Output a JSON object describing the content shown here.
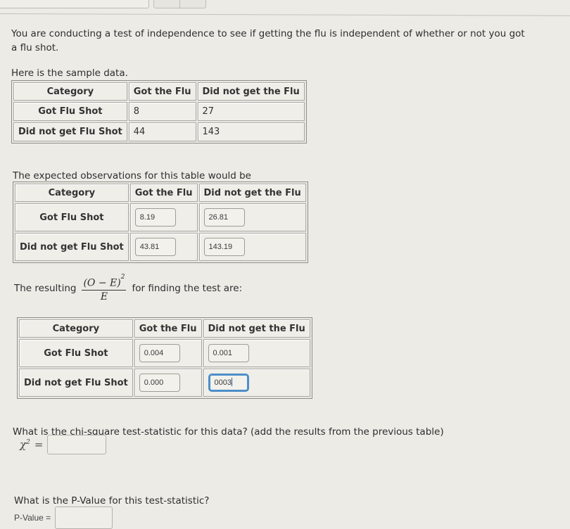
{
  "intro": {
    "question": "You are conducting a test of independence to see if getting the flu is independent of whether or not you got a flu shot.",
    "sample_label": "Here is the sample data.",
    "expected_label": "The expected observations for this table would be",
    "resulting_prefix": "The resulting",
    "formula_numerator": "(O − E)",
    "formula_exponent": "2",
    "formula_denominator": "E",
    "resulting_suffix": "for finding the test are:"
  },
  "columns": [
    "Category",
    "Got the Flu",
    "Did not get the Flu"
  ],
  "observed": {
    "rows": [
      {
        "category": "Got Flu Shot",
        "got_flu": "8",
        "no_flu": "27"
      },
      {
        "category": "Did not get Flu Shot",
        "got_flu": "44",
        "no_flu": "143"
      }
    ]
  },
  "expected": {
    "rows": [
      {
        "category": "Got Flu Shot",
        "got_flu": "8.19",
        "no_flu": "26.81"
      },
      {
        "category": "Did not get Flu Shot",
        "got_flu": "43.81",
        "no_flu": "143.19"
      }
    ]
  },
  "contributions": {
    "rows": [
      {
        "category": "Got Flu Shot",
        "got_flu": "0.004",
        "no_flu": "0.001"
      },
      {
        "category": "Did not get Flu Shot",
        "got_flu": "0.000",
        "no_flu": "0003"
      }
    ]
  },
  "chi_square": {
    "question": "What is the chi-square test-statistic for this data? (add the results from the previous table)",
    "symbol": "χ",
    "exponent": "2",
    "equals": "=",
    "value": ""
  },
  "p_value": {
    "question": "What is the P-Value for this test-statistic?",
    "label": "P-Value =",
    "value": ""
  },
  "colors": {
    "background": "#ecebe6",
    "focus_ring": "#4d8fc9"
  }
}
